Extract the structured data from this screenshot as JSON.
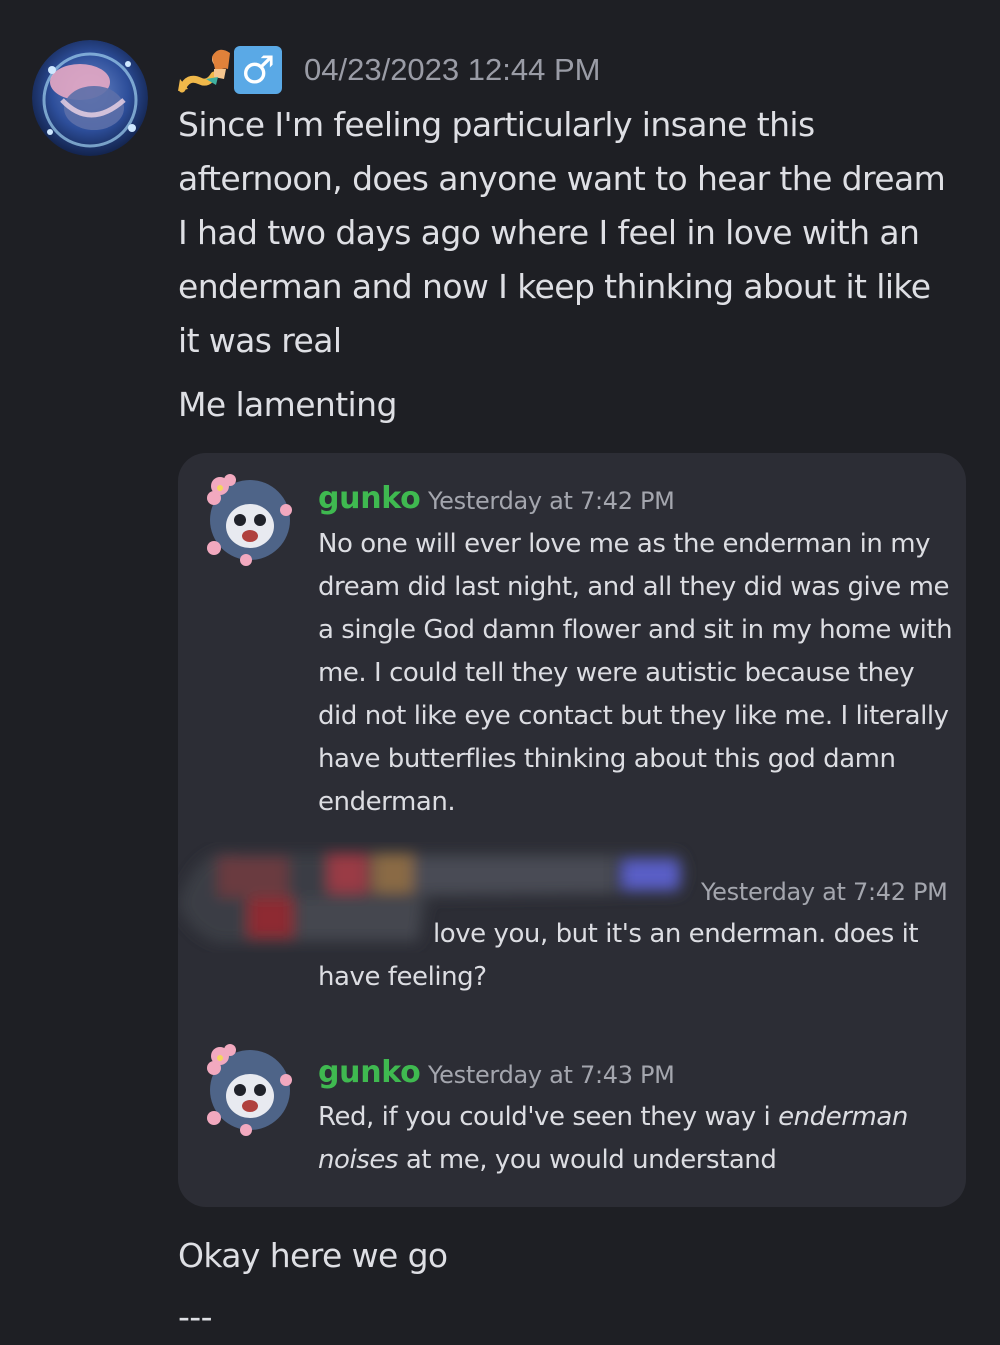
{
  "post": {
    "emojis": [
      "mermaid-emoji",
      "male-sign-emoji"
    ],
    "male_sign": "♂",
    "timestamp": "04/23/2023 12:44 PM",
    "paragraph1": "Since I'm feeling particularly insane this afternoon, does anyone want to hear the dream I had two days ago where I feel in love with an enderman and now I keep thinking about it like it was real",
    "paragraph2": "Me lamenting",
    "paragraph3": "Okay here we go",
    "paragraph4": "---"
  },
  "quoted": {
    "messages": [
      {
        "author": "gunko",
        "timestamp": "Yesterday at 7:42 PM",
        "text": "No one will ever love me as the enderman in my dream did last night, and all they did was give me a single God damn flower and sit in my home with me. I could tell they were autistic because they did not like eye contact but they like me. I literally  have butterflies thinking about this god damn enderman."
      },
      {
        "author": "",
        "timestamp": "Yesterday at 7:42 PM",
        "text": "love you, but it's an enderman. does it have feeling?"
      },
      {
        "author": "gunko",
        "timestamp": "Yesterday at 7:43 PM",
        "text_parts": [
          "Red, if you could've seen they way i ",
          "enderman noises",
          " at me, you would understand"
        ]
      }
    ]
  },
  "colors": {
    "background": "#1e1f24",
    "embed_background": "#2c2d35",
    "username": "#3fb950",
    "timestamp": "#9a9ca6",
    "text": "#dedfe4"
  }
}
